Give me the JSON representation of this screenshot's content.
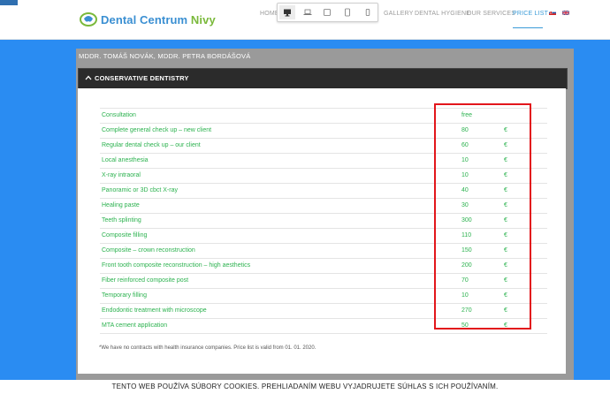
{
  "header": {
    "logo_main": "Dental Centrum",
    "logo_accent": "Nivy",
    "nav": {
      "home": "HOME",
      "gallery": "GALLERY",
      "hygiene": "DENTAL HYGIENE",
      "services": "OUR SERVICES",
      "price_list": "PRICE LIST"
    },
    "device_bar": [
      "desktop-icon",
      "laptop-icon",
      "tablet-landscape-icon",
      "tablet-portrait-icon",
      "phone-icon"
    ],
    "colors": {
      "accent": "#3a9bd8",
      "logo_green": "#7ab93b"
    }
  },
  "panel": {
    "doctors": "MDDR. TOMÁŠ NOVÁK, MDDR. PETRA BORDÁŠOVÁ",
    "section_title": "CONSERVATIVE DENTISTRY",
    "items": [
      {
        "name": "Consultation",
        "value": "free",
        "currency": ""
      },
      {
        "name": "Complete general check up – new client",
        "value": "80",
        "currency": "€"
      },
      {
        "name": "Regular dental check up – our client",
        "value": "60",
        "currency": "€"
      },
      {
        "name": "Local anesthesia",
        "value": "10",
        "currency": "€"
      },
      {
        "name": "X-ray intraoral",
        "value": "10",
        "currency": "€"
      },
      {
        "name": "Panoramic or 3D cbct X-ray",
        "value": "40",
        "currency": "€"
      },
      {
        "name": "Healing paste",
        "value": "30",
        "currency": "€"
      },
      {
        "name": "Teeth splinting",
        "value": "300",
        "currency": "€"
      },
      {
        "name": "Composite filling",
        "value": "110",
        "currency": "€"
      },
      {
        "name": "Composite – crown reconstruction",
        "value": "150",
        "currency": "€"
      },
      {
        "name": "Front tooth composite reconstruction – high aesthetics",
        "value": "200",
        "currency": "€"
      },
      {
        "name": "Fiber reinforced composite post",
        "value": "70",
        "currency": "€"
      },
      {
        "name": "Temporary filling",
        "value": "10",
        "currency": "€"
      },
      {
        "name": "Endodontic treatment with microscope",
        "value": "270",
        "currency": "€"
      },
      {
        "name": "MTA cement application",
        "value": "50",
        "currency": "€"
      }
    ],
    "note": "*We have no contracts with health insurance companies. Price list is valid from 01. 01. 2020."
  },
  "cookie": {
    "text": "TENTO WEB POUŽÍVA SÚBORY COOKIES. PREHLIADANÍM WEBU VYJADRUJETE SÚHLAS S ICH POUŽÍVANÍM."
  }
}
